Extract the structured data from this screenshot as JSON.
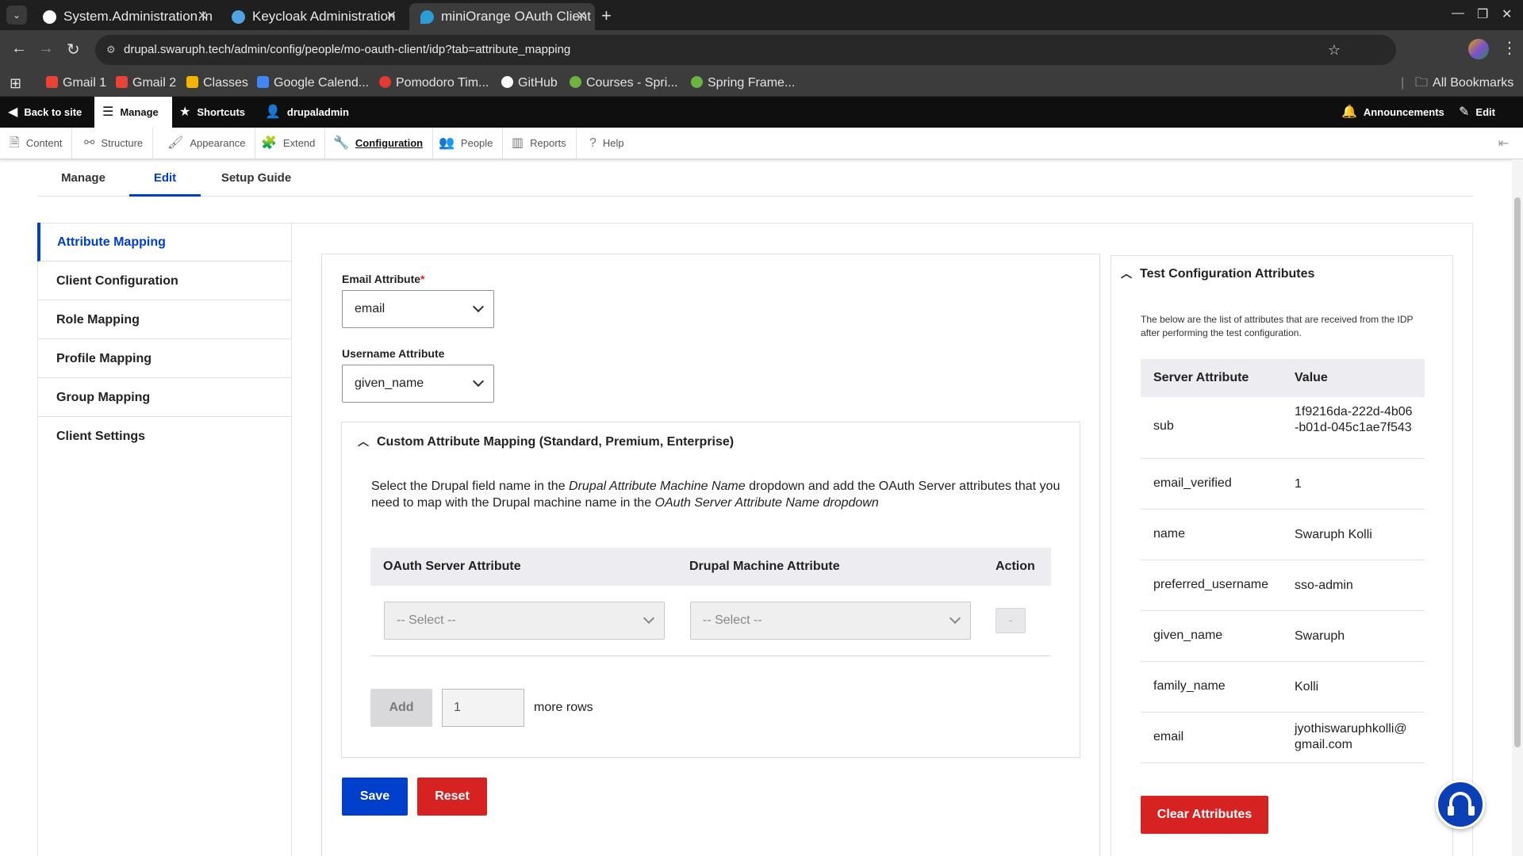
{
  "browser": {
    "tabs": [
      {
        "title": "System.Administration.In",
        "icon": "github-icon"
      },
      {
        "title": "Keycloak Administration",
        "icon": "keycloak-icon"
      },
      {
        "title": "miniOrange OAuth Client",
        "icon": "drupal-icon",
        "active": true
      }
    ],
    "url": "drupal.swaruph.tech/admin/config/people/mo-oauth-client/idp?tab=attribute_mapping",
    "bookmarks": [
      {
        "label": "Gmail 1",
        "icon": "gmail-icon",
        "color": "#ea4335"
      },
      {
        "label": "Gmail 2",
        "icon": "gmail-icon",
        "color": "#ea4335"
      },
      {
        "label": "Classes",
        "icon": "classroom-icon",
        "color": "#f5b400"
      },
      {
        "label": "Google Calend...",
        "icon": "calendar-icon",
        "color": "#4285f4"
      },
      {
        "label": "Pomodoro Tim...",
        "icon": "pomodoro-icon",
        "color": "#e53935"
      },
      {
        "label": "GitHub",
        "icon": "github-icon",
        "color": "#ffffff"
      },
      {
        "label": "Courses - Spri...",
        "icon": "spring-icon",
        "color": "#6db33f"
      },
      {
        "label": "Spring Frame...",
        "icon": "spring-icon",
        "color": "#6db33f"
      }
    ],
    "all_bookmarks": "All Bookmarks"
  },
  "toolbar": {
    "back": "Back to site",
    "manage": "Manage",
    "shortcuts": "Shortcuts",
    "user": "drupaladmin",
    "announcements": "Announcements",
    "edit": "Edit"
  },
  "tray": {
    "items": [
      "Content",
      "Structure",
      "Appearance",
      "Extend",
      "Configuration",
      "People",
      "Reports",
      "Help"
    ],
    "current": "Configuration"
  },
  "subtabs": [
    "Manage",
    "Edit",
    "Setup Guide"
  ],
  "subtab_active": "Edit",
  "sidenav": [
    "Attribute Mapping",
    "Client Configuration",
    "Role Mapping",
    "Profile Mapping",
    "Group Mapping",
    "Client Settings"
  ],
  "sidenav_active": "Attribute Mapping",
  "form": {
    "email_label": "Email Attribute",
    "email_required": "*",
    "email_value": "email",
    "username_label": "Username Attribute",
    "username_value": "given_name",
    "custom": {
      "heading": "Custom Attribute Mapping (Standard, Premium, Enterprise)",
      "desc_1": "Select the Drupal field name in the ",
      "desc_em1": "Drupal Attribute Machine Name",
      "desc_2": " dropdown and add the OAuth Server attributes that you need to map with the Drupal machine name in the ",
      "desc_em2": "OAuth Server Attribute Name dropdown",
      "col_server": "OAuth Server Attribute",
      "col_drupal": "Drupal Machine Attribute",
      "col_action": "Action",
      "server_select": "-- Select --",
      "drupal_select": "-- Select --",
      "remove_label": "-",
      "add_label": "Add",
      "rows_value": "1",
      "rows_suffix": "more rows"
    },
    "save": "Save",
    "reset": "Reset"
  },
  "test_panel": {
    "heading": "Test Configuration Attributes",
    "desc": "The below are the list of attributes that are received from the IDP after performing the test configuration.",
    "col_attr": "Server Attribute",
    "col_value": "Value",
    "rows": [
      {
        "key": "sub",
        "value": "1f9216da-222d-4b06-b01d-045c1ae7f543"
      },
      {
        "key": "email_verified",
        "value": "1"
      },
      {
        "key": "name",
        "value": "Swaruph Kolli"
      },
      {
        "key": "preferred_username",
        "value": "sso-admin"
      },
      {
        "key": "given_name",
        "value": "Swaruph"
      },
      {
        "key": "family_name",
        "value": "Kolli"
      },
      {
        "key": "email",
        "value": "jyothiswaruphkolli@gmail.com"
      }
    ],
    "clear": "Clear Attributes"
  },
  "colors": {
    "accent": "#003ecc",
    "danger": "#d72222"
  }
}
